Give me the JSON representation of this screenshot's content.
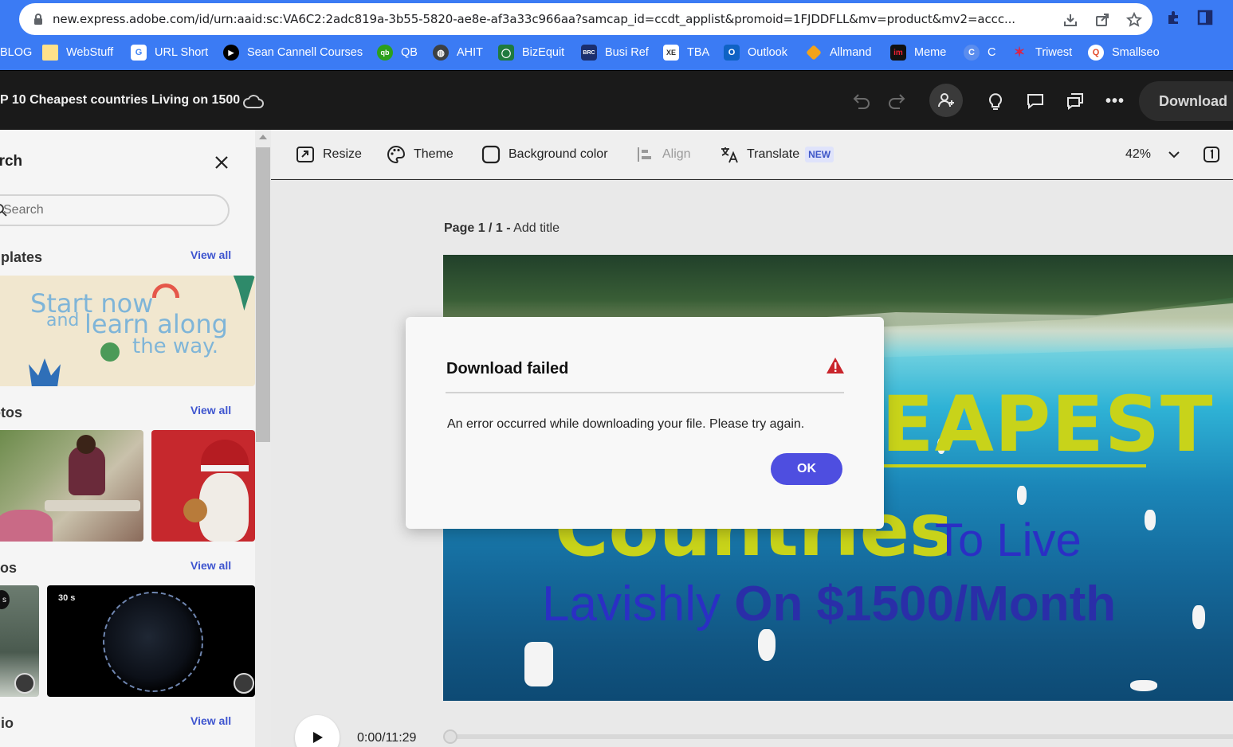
{
  "browser": {
    "url": "new.express.adobe.com/id/urn:aaid:sc:VA6C2:2adc819a-3b55-5820-ae8e-af3a33c966aa?samcap_id=ccdt_applist&promoid=1FJDDFLL&mv=product&mv2=accc...",
    "bookmarks": [
      {
        "label": "BLOG",
        "icon": "blog-icon"
      },
      {
        "label": "WebStuff",
        "icon": "folder-icon"
      },
      {
        "label": "URL Short",
        "icon": "google-icon"
      },
      {
        "label": "Sean Cannell Courses",
        "icon": "play-icon"
      },
      {
        "label": "QB",
        "icon": "quickbooks-icon"
      },
      {
        "label": "AHIT",
        "icon": "globe-icon"
      },
      {
        "label": "BizEquit",
        "icon": "bizequit-icon"
      },
      {
        "label": "Busi Ref",
        "icon": "busiref-icon"
      },
      {
        "label": "TBA",
        "icon": "xe-icon"
      },
      {
        "label": "Outlook",
        "icon": "outlook-icon"
      },
      {
        "label": "Allmand",
        "icon": "allmand-icon"
      },
      {
        "label": "Meme",
        "icon": "meme-icon"
      },
      {
        "label": "C",
        "icon": "c-icon"
      },
      {
        "label": "Triwest",
        "icon": "triwest-icon"
      },
      {
        "label": "Smallseo",
        "icon": "smallseo-icon"
      }
    ]
  },
  "header": {
    "doc_title": "P 10 Cheapest countries Living on 1500",
    "download_label": "Download"
  },
  "left_panel": {
    "heading": "arch",
    "search_placeholder": "Search",
    "sections": [
      {
        "title": "nplates",
        "view_all": "View all"
      },
      {
        "title": "otos",
        "view_all": "View all"
      },
      {
        "title": "eos",
        "view_all": "View all"
      },
      {
        "title": "dio",
        "view_all": "View all"
      }
    ],
    "template_text": {
      "line1": "Start now",
      "line2a": "and",
      "line2b": "learn along",
      "line3": "the way."
    },
    "video_badges": [
      "s",
      "30 s"
    ]
  },
  "toolbar": {
    "resize": "Resize",
    "theme": "Theme",
    "background_color": "Background color",
    "align": "Align",
    "translate": "Translate",
    "new_badge": "NEW",
    "zoom": "42%"
  },
  "canvas": {
    "page_label_bold": "Page 1 / 1 -",
    "page_label_rest": "Add title",
    "slide_text": {
      "cheapest": "EAPEST",
      "countries": "Countries",
      "to_live": "To Live",
      "lavishly": "Lavishly",
      "on_amount": "On $1500/Month"
    },
    "time": "0:00/11:29"
  },
  "dialog": {
    "title": "Download failed",
    "message": "An error occurred while downloading your file. Please try again.",
    "ok_label": "OK",
    "colors": {
      "ok": "#4e4ee0",
      "warning": "#c9252c"
    }
  }
}
